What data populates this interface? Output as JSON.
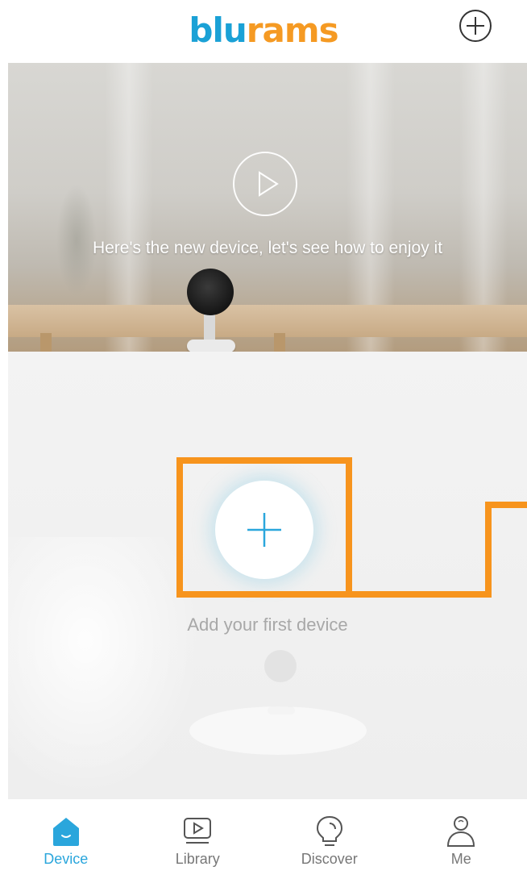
{
  "header": {
    "logo_blu": "blu",
    "logo_rams": "rams",
    "brand_colors": {
      "blu": "#1aa1d6",
      "rams": "#f59a23"
    },
    "add_icon": "plus-circle-icon"
  },
  "banner": {
    "caption": "Here's the new device, let's see how to enjoy it",
    "play_icon": "play-circle-icon"
  },
  "empty_state": {
    "add_icon": "plus-icon",
    "label": "Add your first device"
  },
  "annotation": {
    "color": "#f7941d"
  },
  "tabs": [
    {
      "label": "Device",
      "icon": "home-icon",
      "active": true
    },
    {
      "label": "Library",
      "icon": "video-library-icon",
      "active": false
    },
    {
      "label": "Discover",
      "icon": "lightbulb-icon",
      "active": false
    },
    {
      "label": "Me",
      "icon": "person-icon",
      "active": false
    }
  ],
  "accent_color": "#2aa6dc"
}
